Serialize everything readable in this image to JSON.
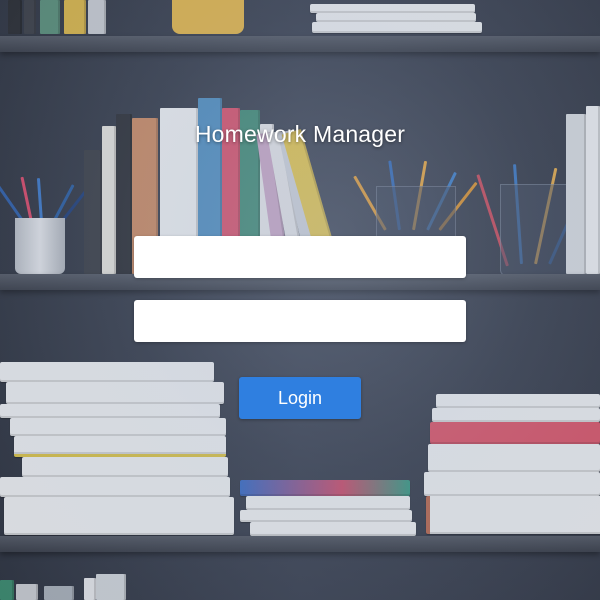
{
  "app": {
    "title": "Homework Manager"
  },
  "login_form": {
    "username": {
      "value": "",
      "placeholder": ""
    },
    "password": {
      "value": "",
      "placeholder": ""
    },
    "login_label": "Login"
  },
  "theme": {
    "accent": "#2f7fe0",
    "field_bg": "#ffffff",
    "title_color": "#ffffff"
  }
}
